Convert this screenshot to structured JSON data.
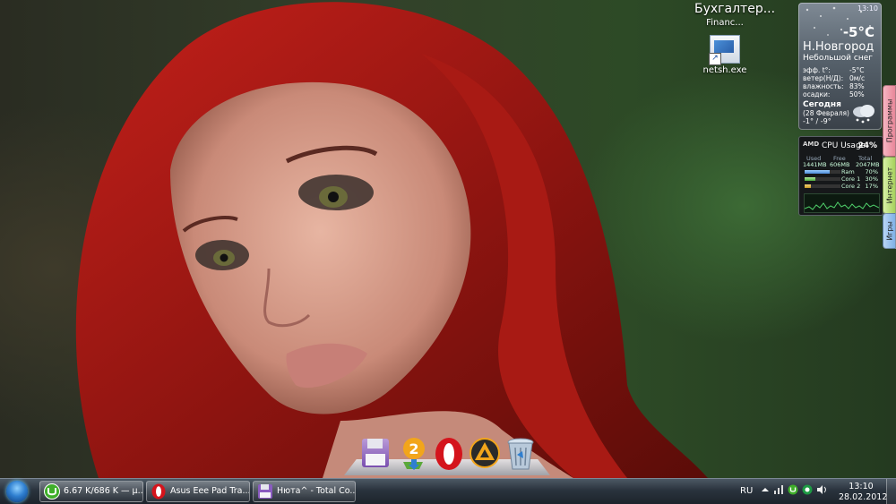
{
  "desktop": {
    "group_title": "Бухгалтер...",
    "shortcut_top_label": "Financ...",
    "shortcut_label": "netsh.exe"
  },
  "weather_gadget": {
    "time": "13:10",
    "temperature": "-5°C",
    "city": "Н.Новгород",
    "condition": "Небольшой снег",
    "rows": [
      {
        "label": "эфф. t°:",
        "value": "-5°C"
      },
      {
        "label": "ветер(Н/Д):",
        "value": "0м/с"
      },
      {
        "label": "влажность:",
        "value": "83%"
      },
      {
        "label": "осадки:",
        "value": "50%"
      }
    ],
    "today_label": "Сегодня",
    "today_date": "(28 Февраля)",
    "today_range": "-1° / -9°"
  },
  "cpu_gadget": {
    "brand": "AMD",
    "title": "CPU Usage",
    "usage": "24%",
    "headers": [
      "Used",
      "Free",
      "Total"
    ],
    "mem_values": [
      "1441MB",
      "606MB",
      "2047MB"
    ],
    "bars": [
      {
        "label": "Ram",
        "value": "70%",
        "fill": 0.7
      },
      {
        "label": "Core 1",
        "value": "30%",
        "fill": 0.3
      },
      {
        "label": "Core 2",
        "value": "17%",
        "fill": 0.17
      }
    ]
  },
  "side_tabs": {
    "programs": "Программы",
    "internet": "Интернет",
    "games": "Игры"
  },
  "dock": {
    "download_badge": "2"
  },
  "taskbar": {
    "buttons": [
      {
        "label": "6.67 K/686 K — µ..."
      },
      {
        "label": "Asus Eee Pad Tra..."
      },
      {
        "label": "Нюта^ - Total Co..."
      }
    ],
    "language": "RU",
    "time": "13:10",
    "date": "28.02.2012"
  },
  "colors": {
    "taskbar": "#2a333d",
    "opera_red": "#d4141c",
    "utorrent_green": "#3fae2a"
  }
}
